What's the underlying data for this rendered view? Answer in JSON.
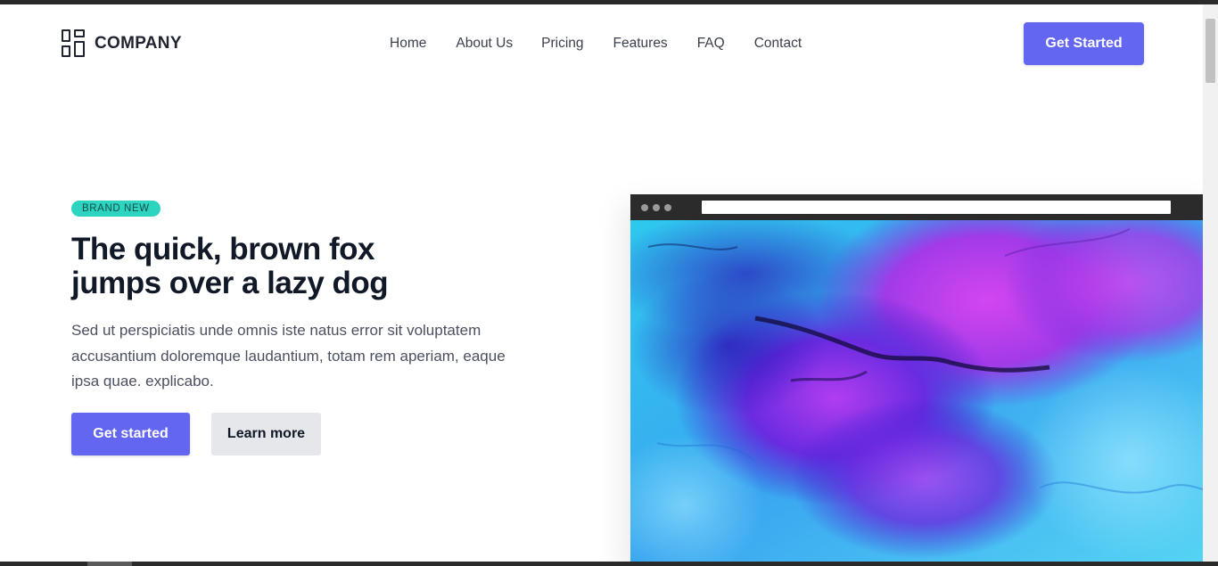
{
  "brand": {
    "name": "COMPANY",
    "icon": "grid-layout-icon"
  },
  "nav": {
    "items": [
      {
        "label": "Home"
      },
      {
        "label": "About Us"
      },
      {
        "label": "Pricing"
      },
      {
        "label": "Features"
      },
      {
        "label": "FAQ"
      },
      {
        "label": "Contact"
      }
    ]
  },
  "header": {
    "cta_label": "Get Started"
  },
  "hero": {
    "badge": "BRAND NEW",
    "title_line1": "The quick, brown fox",
    "title_line2": "jumps over a lazy dog",
    "description": "Sed ut perspiciatis unde omnis iste natus error sit voluptatem accusantium doloremque laudantium, totam rem aperiam, eaque ipsa quae. explicabo.",
    "primary_label": "Get started",
    "secondary_label": "Learn more"
  },
  "mockup": {
    "image": "abstract-ink-artwork"
  },
  "colors": {
    "accent": "#6366f1",
    "badge": "#2dd4bf",
    "secondary_button": "#e5e7eb",
    "heading": "#111827"
  }
}
